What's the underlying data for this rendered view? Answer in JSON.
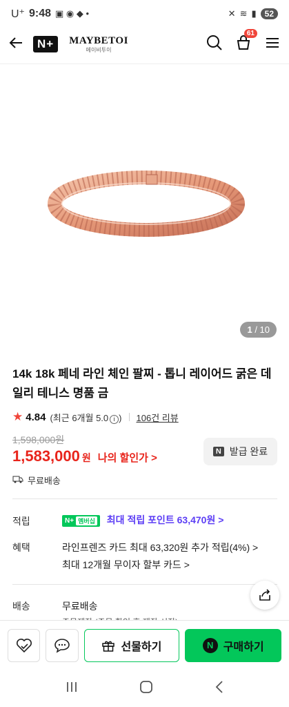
{
  "status_bar": {
    "carrier": "U⁺",
    "time": "9:48",
    "battery": "52"
  },
  "header": {
    "n_plus_logo": "N+",
    "brand_name": "MAYBETOI",
    "brand_sub": "메이비투이",
    "cart_count": "61"
  },
  "gallery": {
    "current": "1",
    "total": "/ 10"
  },
  "product": {
    "title": "14k 18k 페네 라인 체인 팔찌 - 톱니 레이어드 굵은 데일리 테니스 명품 금",
    "rating": "4.84",
    "recent_rating": "(최근 6개월 5.0",
    "recent_rating_close": ")",
    "review_count": "106건 리뷰",
    "original_price": "1,598,000원",
    "price": "1,583,000",
    "price_unit": "원",
    "discount_link": "나의 할인가 >",
    "coupon_label": "발급 완료",
    "coupon_badge": "N",
    "shipping_note": "무료배송"
  },
  "info": {
    "points_label": "적립",
    "points_badge_n": "N+",
    "points_badge_member": "멤버십",
    "points_text": "최대 적립 포인트 63,470원 >",
    "benefit_label": "혜택",
    "benefit_line1": "라인프렌즈 카드 최대 63,320원 추가 적립(4%) >",
    "benefit_line2": "최대 12개월 무이자 할부 카드 >",
    "delivery_label": "배송",
    "delivery_value": "무료배송",
    "delivery_sub": "주문제작 (주문 확인 후 제작 시작)"
  },
  "actions": {
    "gift_label": "선물하기",
    "buy_label": "구매하기",
    "buy_badge": "N"
  },
  "colors": {
    "accent_green": "#03c75a",
    "price_red": "#e8241b",
    "points_purple": "#5b3df5"
  }
}
